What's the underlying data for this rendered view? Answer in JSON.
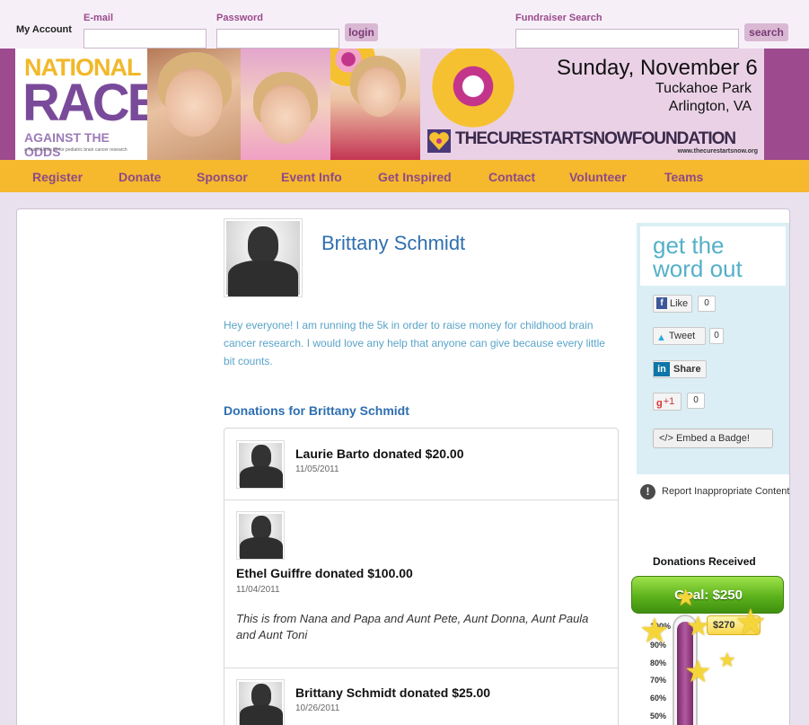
{
  "login": {
    "account_label": "My Account",
    "email_label": "E-mail",
    "email_value": "",
    "password_label": "Password",
    "password_value": "",
    "login_button": "login",
    "search_label": "Fundraiser Search",
    "search_value": "",
    "search_button": "search"
  },
  "banner": {
    "logo_national": "NATIONAL",
    "logo_race": "RACE",
    "logo_odds": "AGAINST THE ODDS",
    "logo_tagline": "a Team Alexis 5k for pediatric brain cancer research",
    "date_line": "Sunday, November 6",
    "venue_line": "Tuckahoe Park",
    "city_line": "Arlington, VA",
    "foundation_name": "THECURESTARTSNOWFOUNDATION",
    "foundation_url": "www.thecurestartsnow.org"
  },
  "nav": {
    "items": [
      "Register",
      "Donate",
      "Sponsor",
      "Event Info",
      "Get Inspired",
      "Contact",
      "Volunteer",
      "Teams"
    ]
  },
  "profile": {
    "name": "Brittany Schmidt",
    "bio": "Hey everyone! I am running the 5k in order to raise money for childhood brain cancer research. I would love any help that anyone can give because every little bit counts."
  },
  "donations": {
    "title": "Donations for Brittany Schmidt",
    "items": [
      {
        "text": "Laurie Barto donated $20.00",
        "date": "11/05/2011",
        "message": ""
      },
      {
        "text": "Ethel Guiffre donated $100.00",
        "date": "11/04/2011",
        "message": "This is from Nana and Papa and Aunt Pete, Aunt Donna, Aunt Paula and Aunt Toni"
      },
      {
        "text": "Brittany Schmidt donated $25.00",
        "date": "10/26/2011",
        "message": ""
      }
    ]
  },
  "share": {
    "title_line1": "get the",
    "title_line2": "word out",
    "like_label": "Like",
    "like_count": "0",
    "tweet_label": "Tweet",
    "tweet_count": "0",
    "share_label": "Share",
    "plusone_label": "+1",
    "plusone_count": "0",
    "embed_label": "</> Embed a Badge!"
  },
  "report": {
    "label": "Report Inappropriate Content"
  },
  "thermometer": {
    "title": "Donations Received",
    "goal_label": "Goal: $250",
    "raised_label": "$270",
    "progress_percent": 100,
    "scale": [
      "100%",
      "90%",
      "80%",
      "70%",
      "60%",
      "50%"
    ]
  },
  "colors": {
    "brand_purple": "#9d4b8e",
    "nav_yellow": "#f6b82c",
    "link_blue": "#2f6fb0",
    "bio_blue": "#5aa4c8",
    "goal_green": "#5cb21c"
  }
}
